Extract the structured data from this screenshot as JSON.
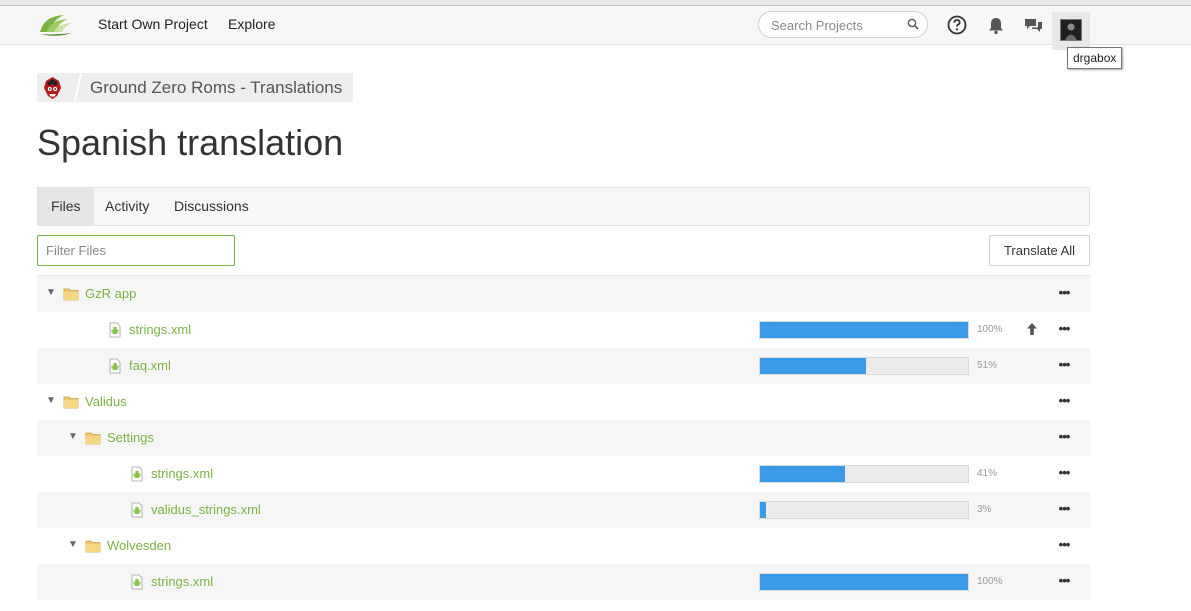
{
  "nav": {
    "links": [
      "Start Own Project",
      "Explore"
    ],
    "search_placeholder": "Search Projects",
    "user_tooltip": "drgabox",
    "icons": [
      "help-icon",
      "notifications-bell-icon",
      "messages-icon"
    ]
  },
  "breadcrumb": {
    "project": "Ground Zero Roms - Translations"
  },
  "page": {
    "title": "Spanish translation"
  },
  "tabs": [
    "Files",
    "Activity",
    "Discussions"
  ],
  "active_tab": "Files",
  "filter_placeholder": "Filter Files",
  "translate_all_label": "Translate All",
  "tree": [
    {
      "type": "folder",
      "name": "GzR app",
      "depth": 0
    },
    {
      "type": "file",
      "name": "strings.xml",
      "depth": 1,
      "progress": 100,
      "progress_label": "100%",
      "upload": true
    },
    {
      "type": "file",
      "name": "faq.xml",
      "depth": 1,
      "progress": 51,
      "progress_label": "51%"
    },
    {
      "type": "folder",
      "name": "Validus",
      "depth": 0
    },
    {
      "type": "folder",
      "name": "Settings",
      "depth": 1
    },
    {
      "type": "file",
      "name": "strings.xml",
      "depth": 2,
      "progress": 41,
      "progress_label": "41%"
    },
    {
      "type": "file",
      "name": "validus_strings.xml",
      "depth": 2,
      "progress": 3,
      "progress_label": "3%"
    },
    {
      "type": "folder",
      "name": "Wolvesden",
      "depth": 1
    },
    {
      "type": "file",
      "name": "strings.xml",
      "depth": 2,
      "progress": 100,
      "progress_label": "100%"
    }
  ],
  "colors": {
    "accent": "#7cb342",
    "progress": "#3b9ae8",
    "folder": "#f0c96a"
  }
}
